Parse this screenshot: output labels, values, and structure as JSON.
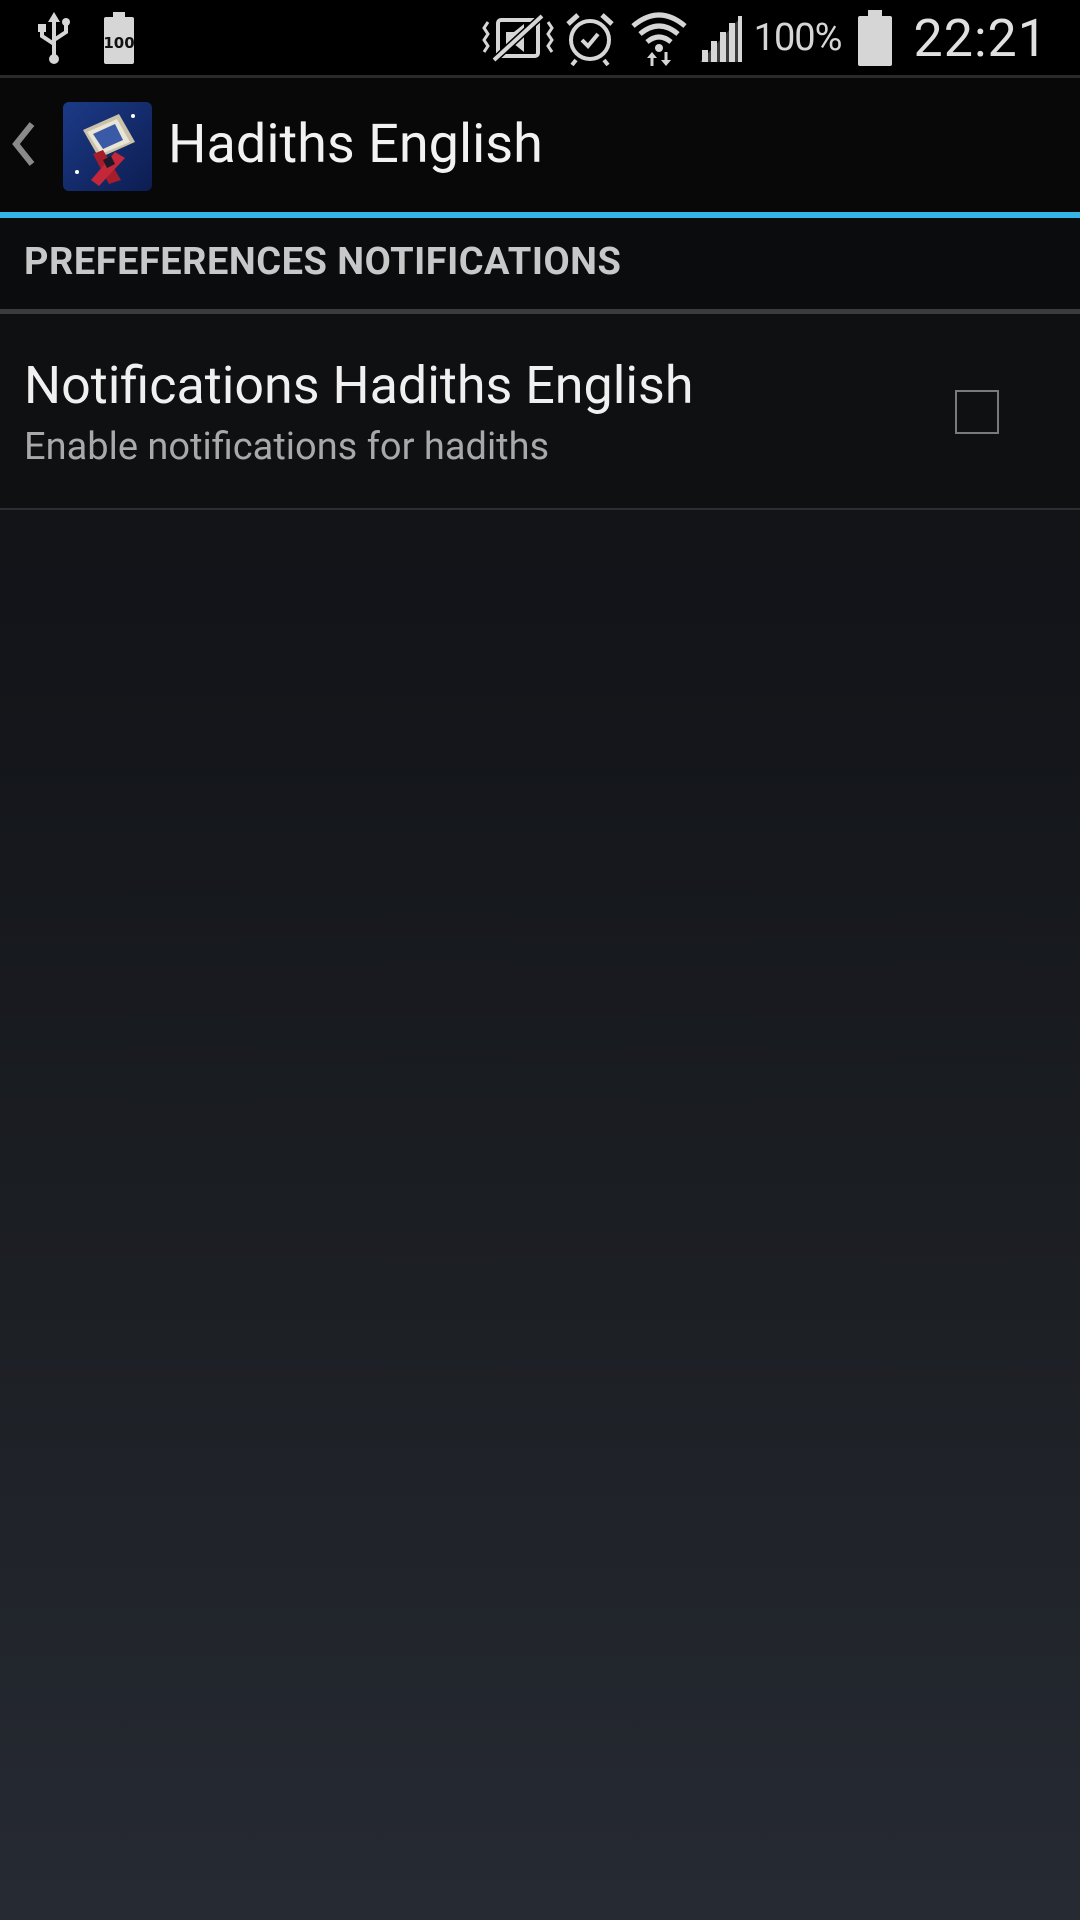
{
  "status_bar": {
    "battery_small_label": "100",
    "battery_percent": "100%",
    "time": "22:21",
    "icons": [
      "usb-icon",
      "battery-small-icon",
      "vibrate-mute-icon",
      "alarm-icon",
      "wifi-icon",
      "signal-icon",
      "battery-icon"
    ]
  },
  "action_bar": {
    "title": "Hadiths English",
    "back_icon": "chevron-left-icon",
    "app_icon": "app-icon"
  },
  "category": {
    "label": "PREFEFERENCES NOTIFICATIONS"
  },
  "preference": {
    "title": "Notifications Hadiths English",
    "summary": "Enable notifications for hadiths",
    "checked": false
  },
  "colors": {
    "accent": "#33b5e5",
    "background_top": "#0e0f11",
    "background_bottom": "#262a33"
  }
}
